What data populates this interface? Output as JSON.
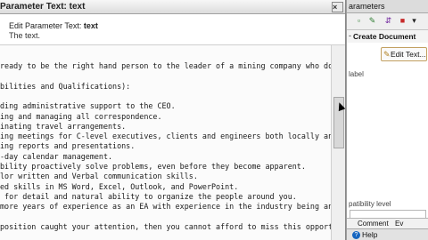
{
  "window": {
    "title": "Parameter Text: text",
    "close_glyph": "×"
  },
  "header": {
    "title_prefix": "Edit Parameter Text: ",
    "title_bold": "text",
    "subtitle": "The text."
  },
  "editor": {
    "lines": [
      "ready to be the right hand person to the leader of a mining company who does",
      "",
      "bilities and Qualifications):",
      "",
      "ding administrative support to the CEO.",
      "ing and managing all correspondence.",
      "inating travel arrangements.",
      "ing meetings for C-level executives, clients and engineers both locally and in",
      "ing reports and presentations.",
      "-day calendar management.",
      "bility proactively solve problems, even before they become apparent.",
      "lor written and Verbal communication skills.",
      "ed skills in MS Word, Excel, Outlook, and PowerPoint.",
      " for detail and natural ability to organize the people around you.",
      "more years of experience as an EA with experience in the industry being an ass",
      "",
      "position caught your attention, then you cannot afford to miss this opportuni"
    ]
  },
  "right_panel": {
    "title": "arameters",
    "toolbar_icons": [
      "add-icon",
      "edit-icon",
      "move-icon",
      "delete-icon",
      "dropdown-icon"
    ],
    "section_label": "Create Document",
    "edit_button_label": "Edit Text...",
    "label_text": "label",
    "compat_label": "patibility level",
    "tabs": [
      "Comment",
      "Ev"
    ],
    "help_label": "Help"
  },
  "colors": {
    "edit_border": "#c2a060",
    "help_icon": "#1565c0"
  }
}
